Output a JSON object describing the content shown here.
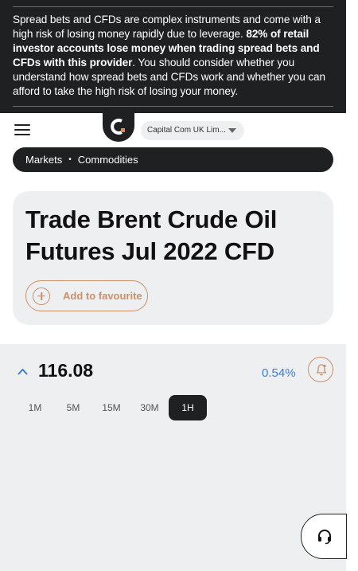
{
  "risk_warning": {
    "text_before": "Spread bets and CFDs are complex instruments and come with a high risk of losing money rapidly due to leverage. ",
    "text_bold": "82% of retail investor accounts lose money when trading spread bets and CFDs with this provider",
    "text_after": ". You should consider whether you understand how spread bets and CFDs work and whether you can afford to take the high risk of losing your money."
  },
  "header": {
    "entity_selector": "Capital Com UK Lim..."
  },
  "breadcrumb": {
    "items": [
      "Markets",
      "Commodities"
    ],
    "separator": "•"
  },
  "instrument": {
    "title": "Trade Brent Crude Oil Futures Jul 2022 CFD",
    "favourite_label": "Add to favourite"
  },
  "quote": {
    "price": "116.08",
    "change": "0.54%",
    "timeframes": [
      "1M",
      "5M",
      "15M",
      "30M",
      "1H"
    ],
    "active_timeframe": "1H"
  },
  "colors": {
    "dark": "#1f2022",
    "accent": "#c9906a",
    "positive": "#3b7dd8",
    "panel": "#eeeff1"
  },
  "icons": {
    "menu": "hamburger-icon",
    "favourite": "plus-circle-icon",
    "price_direction": "chevron-up-icon",
    "alert": "bell-icon",
    "support": "headset-icon"
  }
}
